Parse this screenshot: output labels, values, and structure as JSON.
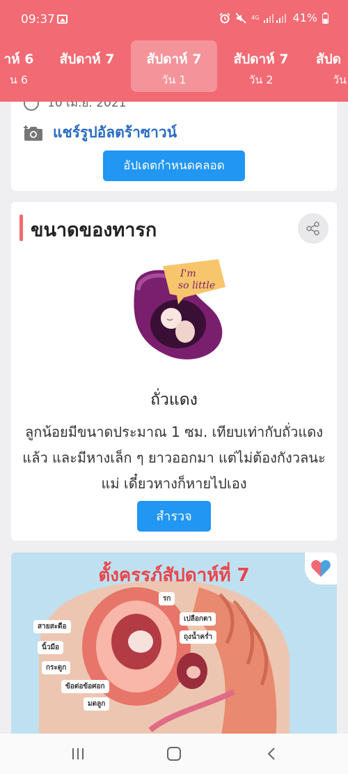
{
  "status_bar": {
    "time": "09:37",
    "battery": "41%",
    "network": "4G"
  },
  "week_tabs": [
    {
      "week": "าห์ 6",
      "day": "น 6",
      "active": false
    },
    {
      "week": "สัปดาห์ 7",
      "day": "",
      "active": false
    },
    {
      "week": "สัปดาห์ 7",
      "day": "วัน 1",
      "active": true
    },
    {
      "week": "สัปดาห์ 7",
      "day": "วัน 2",
      "active": false
    },
    {
      "week": "สัปด",
      "day": "วัน",
      "active": false
    }
  ],
  "due_card": {
    "date": "10 เม.ย. 2021",
    "share_ultrasound": "แชร์รูปอัลตร้าซาวน์",
    "update_button": "อัปเดตกำหนดคลอด"
  },
  "baby_size": {
    "title": "ขนาดของทารก",
    "speech_bubble": "I'm so little",
    "fruit_name": "ถั่วแดง",
    "description": "ลูกน้อยมีขนาดประมาณ 1 ซม. เทียบเท่ากับถั่วแดงแล้ว และมีหางเล็ก ๆ ยาวออกมา แต่ไม่ต้องกังวลนะแม่ เดี๋ยวหางก็หายไปเอง",
    "explore_button": "สำรวจ"
  },
  "infographic": {
    "title": "ตั้งครรภ์สัปดาห์ที่ 7",
    "labels": [
      "รก",
      "เปลือกตา",
      "ถุงน้ำคร่ำ",
      "สายสะดือ",
      "นิ้วมือ",
      "กระดูก",
      "ข้อต่อข้อศอก",
      "มดลูก"
    ]
  },
  "colors": {
    "header": "#f26a73",
    "accent": "#f26a73",
    "button": "#2196f3",
    "link": "#2a6bc2"
  },
  "icons": [
    "image-icon",
    "alarm-icon",
    "mute-icon",
    "signal-icon",
    "battery-icon",
    "clock-icon",
    "camera-icon",
    "share-icon",
    "heart-icon",
    "recents-icon",
    "home-icon",
    "back-icon"
  ]
}
